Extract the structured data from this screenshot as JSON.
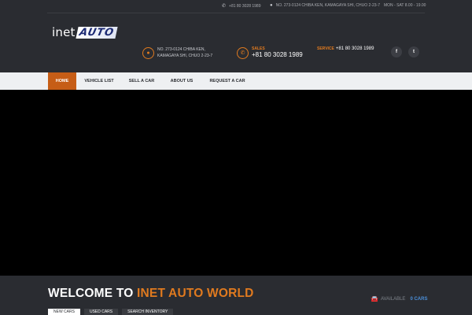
{
  "topbar": {
    "phone": "+81 80 3028 1989",
    "address": "NO. 273-0124 CHIBA KEN, KAMAGAYA SHI, CHUO 2-23-7",
    "hours": "MON - SAT 8.00 - 19.00"
  },
  "logo": {
    "prefix": "inet",
    "brand": "AUTO"
  },
  "contact": {
    "address_line1": "NO. 273-0124 CHIBA KEN,",
    "address_line2": "KAMAGAYA SHI, CHUO 2-23-7",
    "sales_label": "SALES",
    "sales_number": "+81 80 3028 1989",
    "service_label": "SERVICE",
    "service_number": "+81 80 3028 1989"
  },
  "social": {
    "facebook": "f",
    "twitter": "t"
  },
  "nav": {
    "items": [
      "HOME",
      "VEHICLE LIST",
      "SELL A CAR",
      "ABOUT US",
      "REQUEST A CAR"
    ],
    "active": "HOME"
  },
  "welcome": {
    "title_part1": "WELCOME TO",
    "title_part2": "INET AUTO WORLD",
    "available_label": "AVAILABLE",
    "available_count": "0 CARS"
  },
  "tabs": [
    "NEW CARS",
    "USED CARS",
    "SEARCH INVENTORY"
  ],
  "icons": {
    "phone": "phone-icon",
    "location": "map-pin-icon",
    "car": "car-icon"
  },
  "colors": {
    "accent": "#e07a1f",
    "nav_active": "#c65d16",
    "header_bg": "#2a2c31",
    "count_blue": "#4b8fd9"
  }
}
